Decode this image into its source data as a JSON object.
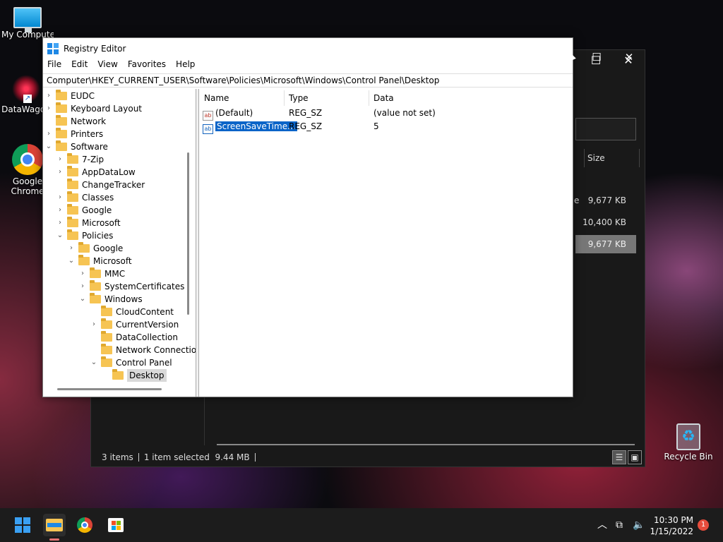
{
  "desktop": {
    "icons": [
      {
        "label": "My Computer"
      },
      {
        "label": "DataWagon"
      },
      {
        "label": "Google Chrome"
      },
      {
        "label": "Recycle Bin"
      }
    ]
  },
  "explorer": {
    "size_header": "Size",
    "sizes": [
      "9,677 KB",
      "10,400 KB",
      "9,677 KB"
    ],
    "partial_name": "e",
    "status": {
      "items": "3 items",
      "selected": "1 item selected",
      "size": "9.44 MB"
    },
    "maximize_glyph": "☐",
    "close_glyph": "✕"
  },
  "regedit": {
    "title": "Registry Editor",
    "menu": [
      "File",
      "Edit",
      "View",
      "Favorites",
      "Help"
    ],
    "address": "Computer\\HKEY_CURRENT_USER\\Software\\Policies\\Microsoft\\Windows\\Control Panel\\Desktop",
    "tree": [
      {
        "label": "EUDC",
        "chev": "›"
      },
      {
        "label": "Keyboard Layout",
        "chev": "›"
      },
      {
        "label": "Network",
        "chev": ""
      },
      {
        "label": "Printers",
        "chev": "›"
      },
      {
        "label": "Software",
        "chev": "⌄"
      },
      {
        "label": "7-Zip",
        "chev": "›"
      },
      {
        "label": "AppDataLow",
        "chev": "›"
      },
      {
        "label": "ChangeTracker",
        "chev": ""
      },
      {
        "label": "Classes",
        "chev": "›"
      },
      {
        "label": "Google",
        "chev": "›"
      },
      {
        "label": "Microsoft",
        "chev": "›"
      },
      {
        "label": "Policies",
        "chev": "⌄"
      },
      {
        "label": "Google",
        "chev": "›"
      },
      {
        "label": "Microsoft",
        "chev": "⌄"
      },
      {
        "label": "MMC",
        "chev": "›"
      },
      {
        "label": "SystemCertificates",
        "chev": "›"
      },
      {
        "label": "Windows",
        "chev": "⌄"
      },
      {
        "label": "CloudContent",
        "chev": ""
      },
      {
        "label": "CurrentVersion",
        "chev": "›"
      },
      {
        "label": "DataCollection",
        "chev": ""
      },
      {
        "label": "Network Connections",
        "chev": ""
      },
      {
        "label": "Control Panel",
        "chev": "⌄"
      },
      {
        "label": "Desktop",
        "chev": ""
      }
    ],
    "columns": [
      "Name",
      "Type",
      "Data"
    ],
    "values": [
      {
        "name": "(Default)",
        "type": "REG_SZ",
        "data": "(value not set)"
      },
      {
        "name": "ScreenSaveTime...",
        "type": "REG_SZ",
        "data": "5"
      }
    ],
    "value_icon_text": "ab"
  },
  "taskbar": {
    "clock_time": "10:30 PM",
    "clock_date": "1/15/2022",
    "notification_count": "1",
    "chevron": "︿"
  }
}
